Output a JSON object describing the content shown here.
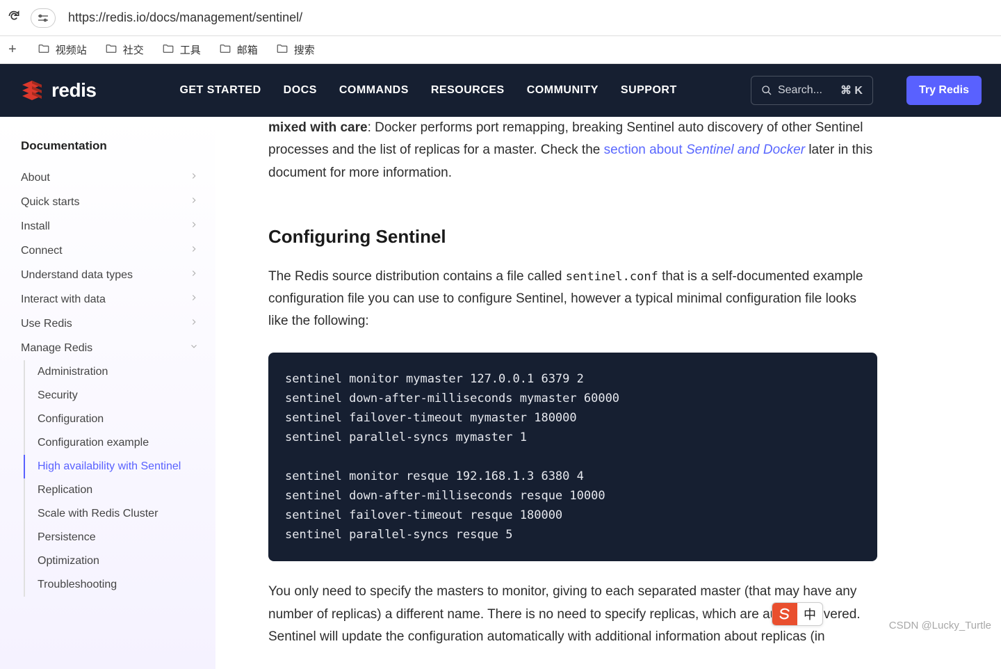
{
  "browser": {
    "url": "https://redis.io/docs/management/sentinel/",
    "site_settings_glyph": "⚙"
  },
  "bookmarks": [
    "视频站",
    "社交",
    "工具",
    "邮箱",
    "搜索"
  ],
  "nav": {
    "brand": "redis",
    "links": [
      "GET STARTED",
      "DOCS",
      "COMMANDS",
      "RESOURCES",
      "COMMUNITY",
      "SUPPORT"
    ],
    "search_placeholder": "Search...",
    "search_kbd": "⌘ K",
    "try_label": "Try Redis"
  },
  "sidebar": {
    "heading": "Documentation",
    "items": [
      {
        "label": "About",
        "expandable": true
      },
      {
        "label": "Quick starts",
        "expandable": true
      },
      {
        "label": "Install",
        "expandable": true
      },
      {
        "label": "Connect",
        "expandable": true
      },
      {
        "label": "Understand data types",
        "expandable": true
      },
      {
        "label": "Interact with data",
        "expandable": true
      },
      {
        "label": "Use Redis",
        "expandable": true
      },
      {
        "label": "Manage Redis",
        "expandable": true,
        "open": true,
        "children": [
          {
            "label": "Administration"
          },
          {
            "label": "Security",
            "expandable": true
          },
          {
            "label": "Configuration"
          },
          {
            "label": "Configuration example"
          },
          {
            "label": "High availability with Sentinel",
            "active": true
          },
          {
            "label": "Replication"
          },
          {
            "label": "Scale with Redis Cluster"
          },
          {
            "label": "Persistence"
          },
          {
            "label": "Optimization",
            "expandable": true
          },
          {
            "label": "Troubleshooting"
          }
        ]
      }
    ]
  },
  "content": {
    "para1_bold": "mixed with care",
    "para1_rest": ": Docker performs port remapping, breaking Sentinel auto discovery of other Sentinel processes and the list of replicas for a master. Check the ",
    "para1_link1": "section about ",
    "para1_link_em": "Sentinel and Docker",
    "para1_tail": " later in this document for more information.",
    "heading": "Configuring Sentinel",
    "para2_a": "The Redis source distribution contains a file called ",
    "para2_code": "sentinel.conf",
    "para2_b": " that is a self-documented example configuration file you can use to configure Sentinel, however a typical minimal configuration file looks like the following:",
    "code": "sentinel monitor mymaster 127.0.0.1 6379 2\nsentinel down-after-milliseconds mymaster 60000\nsentinel failover-timeout mymaster 180000\nsentinel parallel-syncs mymaster 1\n\nsentinel monitor resque 192.168.1.3 6380 4\nsentinel down-after-milliseconds resque 10000\nsentinel failover-timeout resque 180000\nsentinel parallel-syncs resque 5",
    "para3": "You only need to specify the masters to monitor, giving to each separated master (that may have any number of replicas) a different name. There is no need to specify replicas, which are auto-discovered. Sentinel will update the configuration automatically with additional information about replicas (in"
  },
  "ime": {
    "zhong": "中"
  },
  "watermark": "CSDN @Lucky_Turtle"
}
